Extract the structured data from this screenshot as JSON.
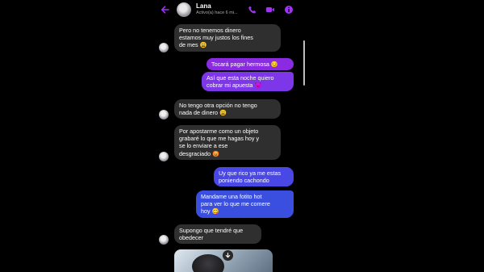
{
  "header": {
    "contact_name": "Lana",
    "status": "Activo(a) hace 6 mi..."
  },
  "icons": {
    "back": "arrow-left-icon",
    "avatar": "avatar",
    "call": "phone-icon",
    "video": "video-camera-icon",
    "info": "info-icon",
    "download": "arrow-down-icon"
  },
  "colors": {
    "accent": "#a133f5",
    "received_bubble": "#2f2f2f",
    "sent_purple": "#8a2be2",
    "sent_blue": "#3a4fe0"
  },
  "messages": [
    {
      "from": "them",
      "text": "Pero no tenemos dinero\nestamos muy justos los fines\nde mes 😩"
    },
    {
      "from": "me",
      "text": "Tocará pagar hermosa 😏"
    },
    {
      "from": "me",
      "text": "Así que esta noche quiero\ncobrar mi apuesta 😈"
    },
    {
      "from": "them",
      "text": "No tengo otra opción no tengo\nnada de dinero 😩"
    },
    {
      "from": "them",
      "text": "Por apostarme como un objeto\ngrabaré lo que me hagas hoy y\nse lo enviare a ese\ndesgraciado 😡"
    },
    {
      "from": "me",
      "text": "Uy que rico ya me estas\nponiendo cachondo"
    },
    {
      "from": "me",
      "text": "Mandame una fotito hot\npara ver lo que me comere\nhoy 😋"
    },
    {
      "from": "them",
      "text": "Supongo que tendré que\nobedecer"
    }
  ]
}
